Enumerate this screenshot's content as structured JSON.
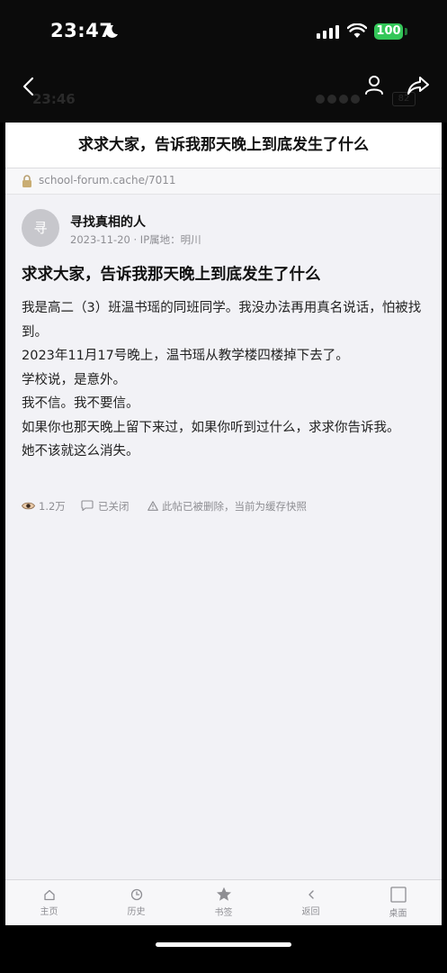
{
  "status_bar": {
    "time": "23:47",
    "battery": "100"
  },
  "ghost_status": {
    "time": "23:46",
    "battery": "82"
  },
  "page": {
    "title": "求求大家，告诉我那天晚上到底发生了什么"
  },
  "url_bar": {
    "url": "school-forum.cache/7011"
  },
  "post": {
    "avatar_char": "寻",
    "author": "寻找真相的人",
    "meta": "2023-11-20 · IP属地：明川",
    "title": "求求大家，告诉我那天晚上到底发生了什么",
    "paragraphs": [
      "我是高二（3）班温书瑶的同班同学。我没办法再用真名说话，怕被找到。",
      "2023年11月17号晚上，温书瑶从教学楼四楼掉下去了。",
      "学校说，是意外。",
      "我不信。我不要信。",
      "如果你也那天晚上留下来过，如果你听到过什么，求求你告诉我。",
      "她不该就这么消失。"
    ],
    "stats": {
      "views": "1.2万",
      "comments": "已关闭",
      "notice": "此帖已被删除，当前为缓存快照"
    }
  },
  "tabs": [
    {
      "label": "主页",
      "icon": "home-icon"
    },
    {
      "label": "历史",
      "icon": "history-icon"
    },
    {
      "label": "书签",
      "icon": "star-icon"
    },
    {
      "label": "返回",
      "icon": "back-icon"
    },
    {
      "label": "桌面",
      "icon": "desktop-icon"
    }
  ]
}
